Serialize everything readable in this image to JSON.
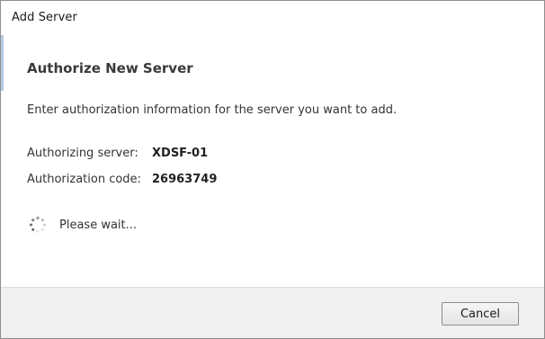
{
  "window": {
    "title": "Add Server"
  },
  "content": {
    "heading": "Authorize New Server",
    "instruction": "Enter authorization information for the server you want to add.",
    "fields": [
      {
        "label": "Authorizing server:",
        "value": "XDSF-01"
      },
      {
        "label": "Authorization code:",
        "value": "26963749"
      }
    ],
    "status": {
      "icon": "spinner-icon",
      "text": "Please wait..."
    }
  },
  "footer": {
    "cancel_label": "Cancel"
  },
  "colors": {
    "heading": "#3a3a3a",
    "footer_bg": "#f0f0f0",
    "border": "#8e8e8e"
  }
}
